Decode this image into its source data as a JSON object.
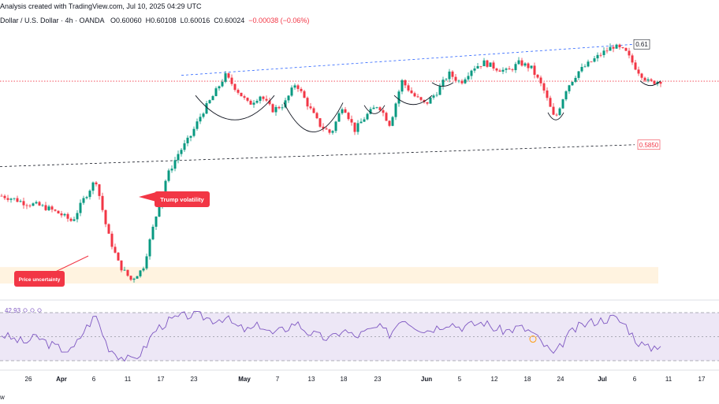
{
  "header": {
    "line1": "Analysis created with TradingView.com, Jul 10, 2025 04:29 UTC",
    "symbol": "Dollar / U.S. Dollar · 4h · OANDA",
    "open": "O0.60060",
    "high": "H0.60108",
    "low": "L0.60016",
    "close": "C0.60024",
    "change": "−0.00038 (−0.06%)"
  },
  "price_labels": {
    "top": "0.61",
    "bottom": "0.5850"
  },
  "callouts": {
    "trump": "Trump volatility",
    "uncertainty": "Price uncertainty"
  },
  "rsi": {
    "value": "42.93"
  },
  "footer": {
    "text": "w"
  },
  "colors": {
    "bull": "#089981",
    "bear": "#f23645",
    "rsi_line": "#7e57c2",
    "rsi_band": "#ede7f6",
    "zone": "#fff3e0",
    "upper_trend": "#2962ff",
    "callout": "#f23645"
  },
  "chart_data": [
    {
      "type": "candlestick",
      "x_tick_labels": [
        "26",
        "Apr",
        "6",
        "11",
        "17",
        "23",
        "May",
        "7",
        "13",
        "18",
        "23",
        "Jun",
        "5",
        "12",
        "18",
        "24",
        "Jul",
        "6",
        "11",
        "17"
      ],
      "price_path": [
        0.571,
        0.5702,
        0.569,
        0.5685,
        0.5675,
        0.566,
        0.564,
        0.5702,
        0.5755,
        0.561,
        0.552,
        0.548,
        0.551,
        0.564,
        0.576,
        0.5825,
        0.587,
        0.5935,
        0.5985,
        0.604,
        0.6,
        0.596,
        0.5985,
        0.5945,
        0.596,
        0.602,
        0.596,
        0.5905,
        0.588,
        0.596,
        0.589,
        0.593,
        0.596,
        0.5905,
        0.6025,
        0.5985,
        0.596,
        0.5995,
        0.6045,
        0.602,
        0.606,
        0.6075,
        0.606,
        0.605,
        0.6075,
        0.606,
        0.6005,
        0.5918,
        0.6005,
        0.605,
        0.6075,
        0.61,
        0.612,
        0.6105,
        0.6055,
        0.602,
        0.6025
      ],
      "trend_upper": [
        0.604,
        0.6125
      ],
      "trend_lower": [
        0.579,
        0.585
      ],
      "current_price": 0.6024,
      "zone": [
        0.547,
        0.5515
      ],
      "annotations": [
        "Trump volatility",
        "Price uncertainty"
      ],
      "price_labels": [
        "0.61",
        "0.5850"
      ]
    },
    {
      "type": "line",
      "name": "RSI",
      "value": 42.93,
      "ylim": [
        30,
        70
      ],
      "bands": [
        30,
        50,
        70
      ],
      "values": [
        52,
        48,
        45,
        50,
        44,
        40,
        38,
        55,
        68,
        42,
        34,
        30,
        38,
        55,
        62,
        66,
        68,
        67,
        64,
        66,
        58,
        55,
        60,
        52,
        56,
        62,
        54,
        50,
        48,
        56,
        50,
        54,
        58,
        52,
        66,
        60,
        55,
        58,
        62,
        58,
        60,
        62,
        56,
        55,
        58,
        54,
        44,
        34,
        50,
        58,
        62,
        64,
        66,
        60,
        46,
        40,
        44
      ]
    }
  ]
}
